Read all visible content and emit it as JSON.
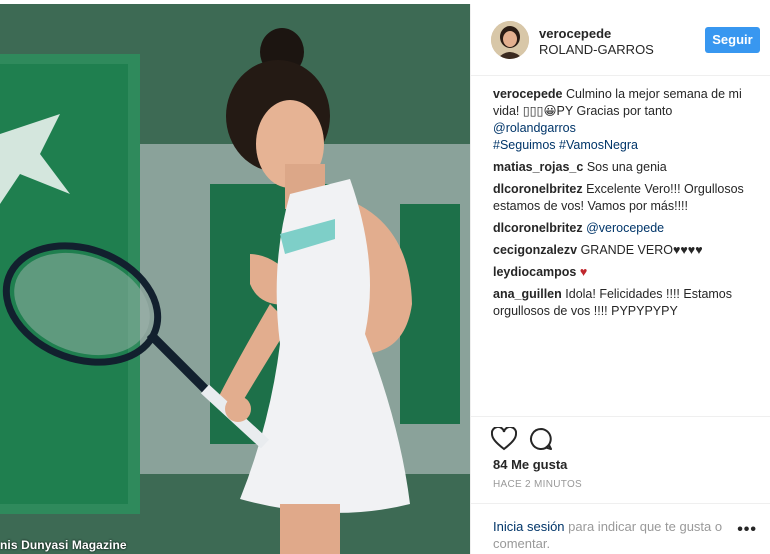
{
  "photo": {
    "watermark": "nis Dunyasi Magazine"
  },
  "header": {
    "username": "verocepede",
    "location": "ROLAND-GARROS",
    "follow_label": "Seguir"
  },
  "caption": {
    "user": "verocepede",
    "text": "Culmino la mejor semana de mi vida! ▯▯▯😀PY Gracias por tanto",
    "mention": "@rolandgarros",
    "hashtags": "#Seguimos #VamosNegra"
  },
  "comments": [
    {
      "user": "matias_rojas_c",
      "text": "Sos una genia"
    },
    {
      "user": "dlcoronelbritez",
      "text": "Excelente Vero!!! Orgullosos estamos de vos! Vamos por más!!!!"
    },
    {
      "user": "dlcoronelbritez",
      "text": "@verocepede"
    },
    {
      "user": "cecigonzalezv",
      "text": "GRANDE VERO♥♥♥♥"
    },
    {
      "user": "leydiocampos",
      "text": "♥"
    },
    {
      "user": "ana_guillen",
      "text": "Idola! Felicidades !!!! Estamos orgullosos de vos !!!! PYPYPYPY"
    }
  ],
  "actions": {
    "likes": "84 Me gusta",
    "time": "HACE 2 MINUTOS",
    "login_link": "Inicia sesión",
    "login_text": "para indicar que te gusta o comentar.",
    "more_label": "•••"
  },
  "colors": {
    "follow_button": "#3897f0",
    "link": "#003569",
    "heart": "#c0272d"
  }
}
